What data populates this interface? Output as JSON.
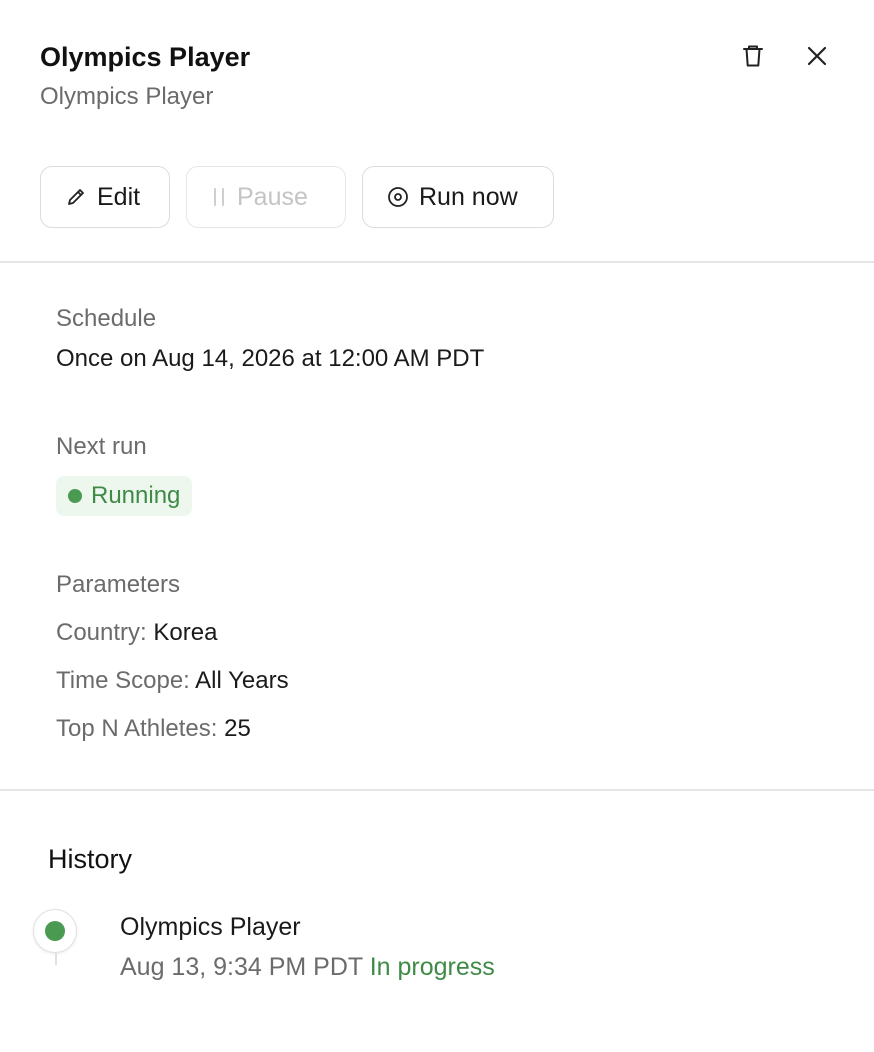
{
  "header": {
    "title": "Olympics Player",
    "subtitle": "Olympics Player",
    "delete_icon": "trash-icon",
    "close_icon": "close-icon"
  },
  "actions": {
    "edit_label": "Edit",
    "pause_label": "Pause",
    "run_now_label": "Run now"
  },
  "schedule": {
    "label": "Schedule",
    "value": "Once on Aug 14, 2026 at 12:00 AM PDT"
  },
  "next_run": {
    "label": "Next run",
    "status": "Running",
    "status_color": "#3f8a47"
  },
  "parameters": {
    "label": "Parameters",
    "items": [
      {
        "key": "Country:",
        "value": "Korea"
      },
      {
        "key": "Time Scope:",
        "value": "All Years"
      },
      {
        "key": "Top N Athletes:",
        "value": "25"
      }
    ]
  },
  "history": {
    "title": "History",
    "entries": [
      {
        "name": "Olympics Player",
        "time": "Aug 13, 9:34 PM PDT",
        "status": "In progress"
      }
    ]
  }
}
